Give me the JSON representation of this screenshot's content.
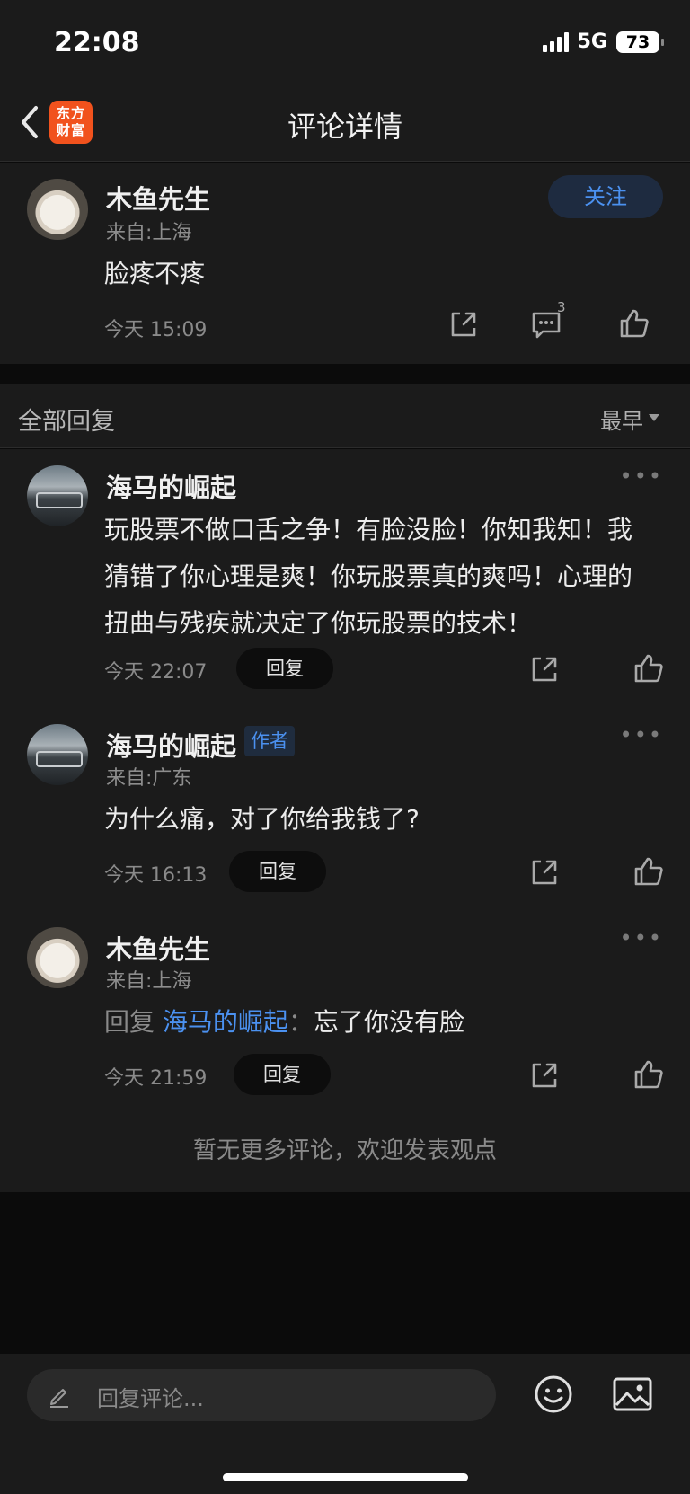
{
  "status_bar": {
    "time": "22:08",
    "network": "5G",
    "battery": "73"
  },
  "nav": {
    "title": "评论详情",
    "logo_line1": "东方",
    "logo_line2": "财富"
  },
  "main_comment": {
    "username": "木鱼先生",
    "location": "来自:上海",
    "text": "脸疼不疼",
    "time": "今天 15:09",
    "follow_label": "关注",
    "comment_count": "3"
  },
  "replies_header": {
    "title": "全部回复",
    "sort_label": "最早"
  },
  "replies": [
    {
      "username": "海马的崛起",
      "text": "玩股票不做口舌之争！有脸没脸！你知我知！我猜错了你心理是爽！你玩股票真的爽吗！心理的扭曲与残疾就决定了你玩股票的技术！",
      "time": "今天 22:07",
      "reply_label": "回复"
    },
    {
      "username": "海马的崛起",
      "badge": "作者",
      "location": "来自:广东",
      "text": "为什么痛，对了你给我钱了?",
      "time": "今天 16:13",
      "reply_label": "回复"
    },
    {
      "username": "木鱼先生",
      "location": "来自:上海",
      "reply_prefix": "回复",
      "reply_target": "海马的崛起",
      "reply_colon": "：",
      "text": "忘了你没有脸",
      "time": "今天 21:59",
      "reply_label": "回复"
    }
  ],
  "footer_note": "暂无更多评论，欢迎发表观点",
  "bottom_bar": {
    "placeholder": "回复评论..."
  },
  "colors": {
    "accent": "#4b91f0",
    "brand": "#f1521d",
    "background": "#1b1b1b"
  },
  "icons": [
    "back-icon",
    "share-icon",
    "comment-icon",
    "like-icon",
    "more-icon",
    "pencil-icon",
    "emoji-icon",
    "image-icon",
    "sort-caret-icon"
  ]
}
